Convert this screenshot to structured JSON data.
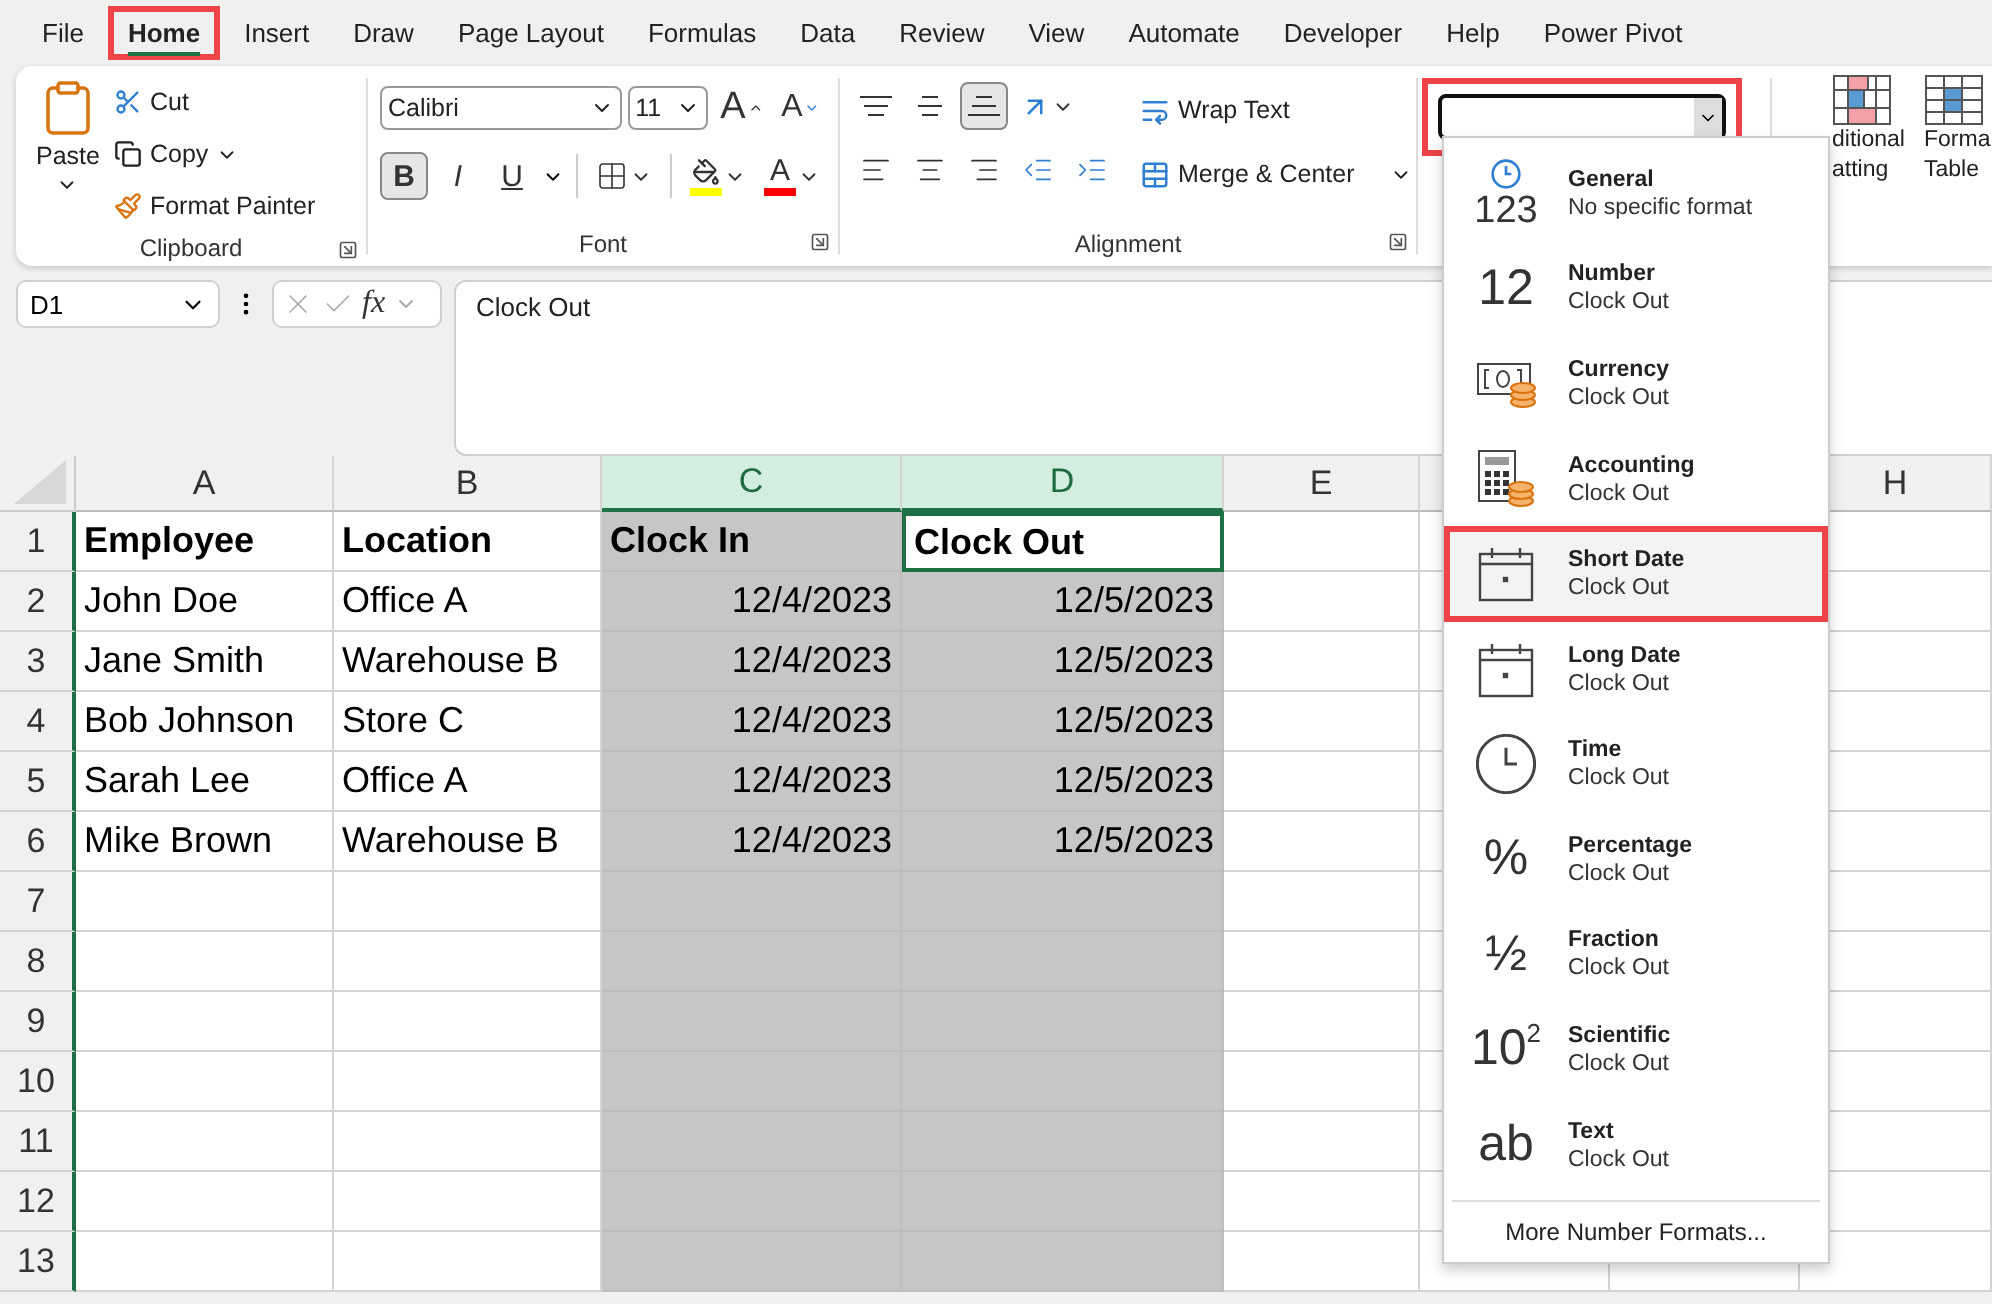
{
  "menu_tabs": [
    {
      "label": "File",
      "selected": false,
      "annotated": false
    },
    {
      "label": "Home",
      "selected": true,
      "annotated": true
    },
    {
      "label": "Insert",
      "selected": false,
      "annotated": false
    },
    {
      "label": "Draw",
      "selected": false,
      "annotated": false
    },
    {
      "label": "Page Layout",
      "selected": false,
      "annotated": false
    },
    {
      "label": "Formulas",
      "selected": false,
      "annotated": false
    },
    {
      "label": "Data",
      "selected": false,
      "annotated": false
    },
    {
      "label": "Review",
      "selected": false,
      "annotated": false
    },
    {
      "label": "View",
      "selected": false,
      "annotated": false
    },
    {
      "label": "Automate",
      "selected": false,
      "annotated": false
    },
    {
      "label": "Developer",
      "selected": false,
      "annotated": false
    },
    {
      "label": "Help",
      "selected": false,
      "annotated": false
    },
    {
      "label": "Power Pivot",
      "selected": false,
      "annotated": false
    }
  ],
  "ribbon": {
    "clipboard": {
      "paste": "Paste",
      "cut": "Cut",
      "copy": "Copy",
      "format_painter": "Format Painter",
      "title": "Clipboard"
    },
    "font": {
      "font_name": "Calibri",
      "font_size": "11",
      "size_buttons": [
        {
          "label": "A",
          "kind": "grow"
        },
        {
          "label": "A",
          "kind": "shrink"
        }
      ],
      "style_buttons": [
        {
          "label": "B",
          "kind": "bold",
          "selected": true
        },
        {
          "label": "I",
          "kind": "italic",
          "selected": false
        },
        {
          "label": "U",
          "kind": "underline",
          "selected": false
        }
      ],
      "font_color": "A",
      "title": "Font"
    },
    "alignment": {
      "vertical": [
        {
          "kind": "top",
          "selected": false
        },
        {
          "kind": "middle",
          "selected": false
        },
        {
          "kind": "bottom",
          "selected": true
        }
      ],
      "wrap_text": "Wrap Text",
      "merge_center": "Merge & Center",
      "title": "Alignment"
    },
    "number": {
      "format_box": {
        "annotated": true
      }
    },
    "styles": [
      {
        "kind": "conditional",
        "lines": [
          "ditional",
          "atting"
        ]
      },
      {
        "kind": "table",
        "lines": [
          "Forma",
          "Table"
        ]
      }
    ]
  },
  "formula_bar": {
    "name_box": "D1",
    "fx": "fx",
    "formula": "Clock Out"
  },
  "sheet": {
    "columns": [
      {
        "label": "A",
        "selected": false
      },
      {
        "label": "B",
        "selected": false
      },
      {
        "label": "C",
        "selected": true
      },
      {
        "label": "D",
        "selected": true
      },
      {
        "label": "E",
        "selected": false
      },
      {
        "selected": false
      },
      {
        "selected": false
      },
      {
        "label": "H",
        "selected": false
      }
    ],
    "rows": [
      {
        "number": "1",
        "kind": "header",
        "cells": [
          {
            "text": "Employee",
            "active": false
          },
          {
            "text": "Location",
            "active": false
          },
          {
            "text": "Clock In",
            "active": false
          },
          {
            "text": "Clock Out",
            "active": true
          }
        ]
      },
      {
        "number": "2",
        "kind": "data",
        "cells": [
          {
            "text": "John Doe",
            "active": false
          },
          {
            "text": "Office A",
            "active": false
          },
          {
            "text": "12/4/2023",
            "active": false
          },
          {
            "text": "12/5/2023",
            "active": false
          }
        ]
      },
      {
        "number": "3",
        "kind": "data",
        "cells": [
          {
            "text": "Jane Smith",
            "active": false
          },
          {
            "text": "Warehouse B",
            "active": false
          },
          {
            "text": "12/4/2023",
            "active": false
          },
          {
            "text": "12/5/2023",
            "active": false
          }
        ]
      },
      {
        "number": "4",
        "kind": "data",
        "cells": [
          {
            "text": "Bob Johnson",
            "active": false
          },
          {
            "text": "Store C",
            "active": false
          },
          {
            "text": "12/4/2023",
            "active": false
          },
          {
            "text": "12/5/2023",
            "active": false
          }
        ]
      },
      {
        "number": "5",
        "kind": "data",
        "cells": [
          {
            "text": "Sarah Lee",
            "active": false
          },
          {
            "text": "Office A",
            "active": false
          },
          {
            "text": "12/4/2023",
            "active": false
          },
          {
            "text": "12/5/2023",
            "active": false
          }
        ]
      },
      {
        "number": "6",
        "kind": "data",
        "cells": [
          {
            "text": "Mike Brown",
            "active": false
          },
          {
            "text": "Warehouse B",
            "active": false
          },
          {
            "text": "12/4/2023",
            "active": false
          },
          {
            "text": "12/5/2023",
            "active": false
          }
        ]
      },
      {
        "number": "7",
        "kind": "data",
        "cells": []
      },
      {
        "number": "8",
        "kind": "data",
        "cells": []
      },
      {
        "number": "9",
        "kind": "data",
        "cells": []
      },
      {
        "number": "10",
        "kind": "data",
        "cells": []
      },
      {
        "number": "11",
        "kind": "data",
        "cells": []
      },
      {
        "number": "12",
        "kind": "data",
        "cells": []
      },
      {
        "number": "13",
        "kind": "data",
        "cells": []
      }
    ]
  },
  "number_format_menu": {
    "items": [
      {
        "name": "General",
        "example": "No specific format",
        "kind": "general",
        "symbol": "123",
        "selected": false,
        "annotated": false
      },
      {
        "name": "Number",
        "example": "Clock Out",
        "kind": "symbol",
        "symbol": "12",
        "selected": false,
        "annotated": false
      },
      {
        "name": "Currency",
        "example": "Clock Out",
        "kind": "currency",
        "selected": false,
        "annotated": false
      },
      {
        "name": "Accounting",
        "example": "Clock Out",
        "kind": "accounting",
        "selected": false,
        "annotated": false
      },
      {
        "name": "Short Date",
        "example": "Clock Out",
        "kind": "date",
        "selected": true,
        "annotated": true
      },
      {
        "name": "Long Date",
        "example": "Clock Out",
        "kind": "date",
        "selected": false,
        "annotated": false
      },
      {
        "name": "Time",
        "example": "Clock Out",
        "kind": "time",
        "selected": false,
        "annotated": false
      },
      {
        "name": "Percentage",
        "example": "Clock Out",
        "kind": "symbol",
        "symbol": "%",
        "selected": false,
        "annotated": false
      },
      {
        "name": "Fraction",
        "example": "Clock Out",
        "kind": "symbol",
        "symbol": "½",
        "selected": false,
        "annotated": false
      },
      {
        "name": "Scientific",
        "example": "Clock Out",
        "kind": "symbol",
        "symbol": "10$^{2}$",
        "selected": false,
        "annotated": false
      },
      {
        "name": "Text",
        "example": "Clock Out",
        "kind": "symbol",
        "symbol": "ab",
        "selected": false,
        "annotated": false
      }
    ],
    "more": "More Number Formats..."
  }
}
